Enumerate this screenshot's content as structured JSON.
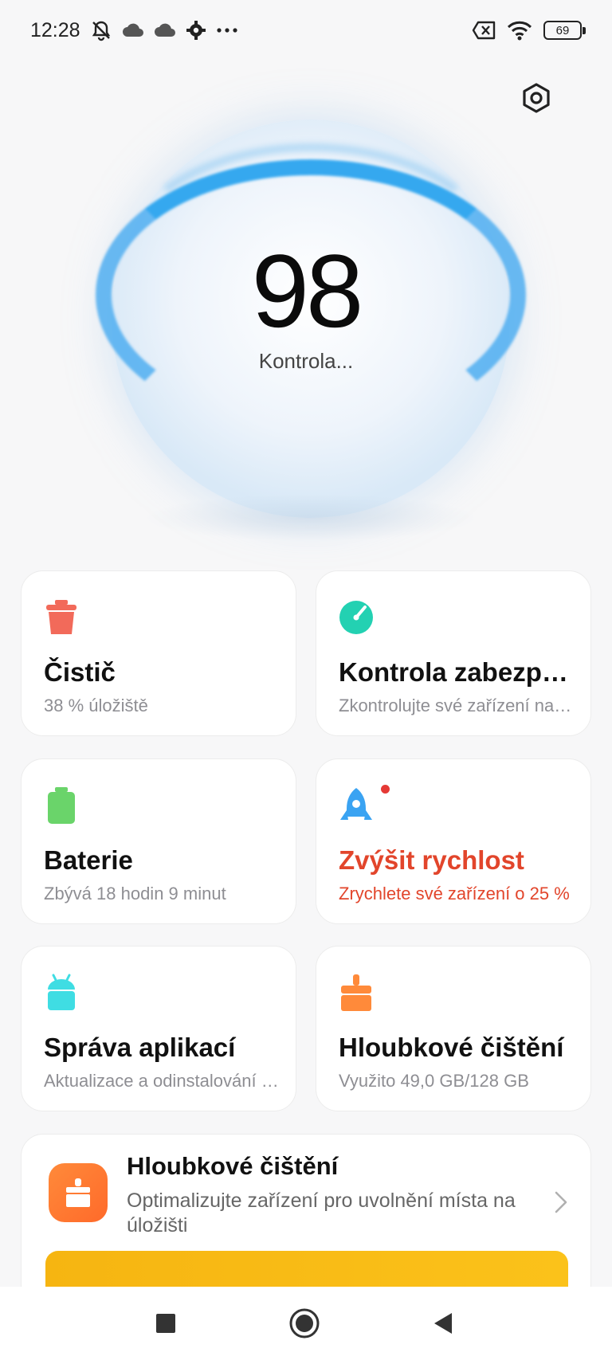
{
  "status_bar": {
    "time": "12:28",
    "icons": [
      "mute-icon",
      "cloud-icon",
      "cloud-icon",
      "gear-icon",
      "more-dots-icon"
    ],
    "battery_level": "69"
  },
  "hero": {
    "score": "98",
    "status": "Kontrola..."
  },
  "cards": [
    {
      "title": "Čistič",
      "subtitle": "38 % úložiště",
      "icon": "trash-icon",
      "color": "#f26a5a"
    },
    {
      "title": "Kontrola zabezpečení",
      "subtitle": "Zkontrolujte své zařízení na hrozby",
      "icon": "shield-check-icon",
      "color": "#23d1b2"
    },
    {
      "title": "Baterie",
      "subtitle": "Zbývá 18 hodin 9 minut",
      "icon": "battery-icon",
      "color": "#6ad46a"
    },
    {
      "title": "Zvýšit rychlost",
      "subtitle": "Zrychlete své zařízení o 25 %",
      "icon": "rocket-icon",
      "color": "#3aa3f2"
    },
    {
      "title": "Správa aplikací",
      "subtitle": "Aktualizace a odinstalování aplikací",
      "icon": "android-icon",
      "color": "#3fdde3"
    },
    {
      "title": "Hloubkové čištění",
      "subtitle": "Využito 49,0 GB/128 GB",
      "icon": "broom-icon",
      "color": "#ff8a3a"
    }
  ],
  "promo": {
    "title": "Hloubkové čištění",
    "description": "Optimalizujte zařízení pro uvolnění místa na úložišti"
  },
  "colors": {
    "accent_blue": "#35a8ef",
    "alert_red": "#e2452b"
  }
}
